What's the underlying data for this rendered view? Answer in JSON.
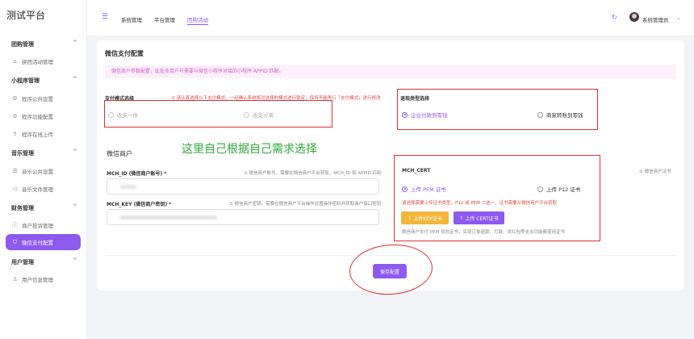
{
  "app": {
    "brand": "测试平台"
  },
  "sidebar": {
    "groups": [
      {
        "label": "团购管理",
        "items": [
          {
            "label": "拼团活动管理",
            "icon": "home-icon"
          }
        ]
      },
      {
        "label": "小程序管理",
        "items": [
          {
            "label": "程序公共设置",
            "icon": "gear-icon"
          },
          {
            "label": "程序功能配置",
            "icon": "ban-icon"
          },
          {
            "label": "程序在线上传",
            "icon": "upload-icon"
          }
        ]
      },
      {
        "label": "音乐管理",
        "items": [
          {
            "label": "音乐公共设置",
            "icon": "sliders-icon"
          },
          {
            "label": "音乐文件管理",
            "icon": "audio-icon"
          }
        ]
      },
      {
        "label": "财务管理",
        "items": [
          {
            "label": "商户投诉管理",
            "icon": "info-icon"
          },
          {
            "label": "微信支付配置",
            "icon": "shield-icon",
            "active": true
          }
        ]
      },
      {
        "label": "用户管理",
        "items": [
          {
            "label": "用户信息管理",
            "icon": "user-icon"
          }
        ]
      }
    ]
  },
  "header": {
    "tabs": [
      {
        "label": "系统管理",
        "selected": false
      },
      {
        "label": "平台管理",
        "selected": false
      },
      {
        "label": "团购活动",
        "selected": true
      }
    ],
    "user_name": "系统管理员"
  },
  "page": {
    "title": "微信支付配置",
    "notice": "微信商户参数配置，此处支商户号需要与微信小程序对接的小程序 APPID 匹配。",
    "pay_mode": {
      "label": "支付模式选择",
      "hint": "① 请认真选择以下支付模式，一经确认系统将对选择的模式进行锁定，保持不能再行「支付模式」进行修改",
      "options": [
        "收支一体",
        "收支分离"
      ]
    },
    "refund": {
      "label": "退现类型选择",
      "options": [
        "企业付款到零钱",
        "商家转账到零钱"
      ],
      "selected": 0
    },
    "merchant": {
      "section_title": "微信商户",
      "mch_id": {
        "label": "MCH_ID (微信商户账号) *",
        "hint": "① 微信商户账号，需要在微信商户平台获取，MCH_ID 和 APPID 匹配"
      },
      "mch_key": {
        "label": "MCH_KEY (微信商户密钥) *",
        "hint": "① 微信商户密钥，需要在微信商户平台操作设置操作密码并获取商户接口密钥"
      }
    },
    "annotation": "这里自己根据自己需求选择",
    "cert": {
      "label": "MCH_CERT",
      "corner_hint": "① 微信商户证书",
      "options": [
        "上传 PEM 证书",
        "上传 P12 证书"
      ],
      "selected": 0,
      "red_note": "请选择需要上传证书类型，P12 或 PEM 二选一，证书需要从微信商户平台获取",
      "btn_key": "上传KEY证书",
      "btn_cert": "上传 CERT证书",
      "bottom_note": "微信商户支付 PEM 双向证书，实现订单退款、打款、发红包等支出功能都使用证书"
    },
    "save_label": "保存配置"
  },
  "colors": {
    "accent": "#8e59ef",
    "annotation_red": "#e03030",
    "annotation_green": "#2eaa3a",
    "key_button": "#f3b63b"
  }
}
